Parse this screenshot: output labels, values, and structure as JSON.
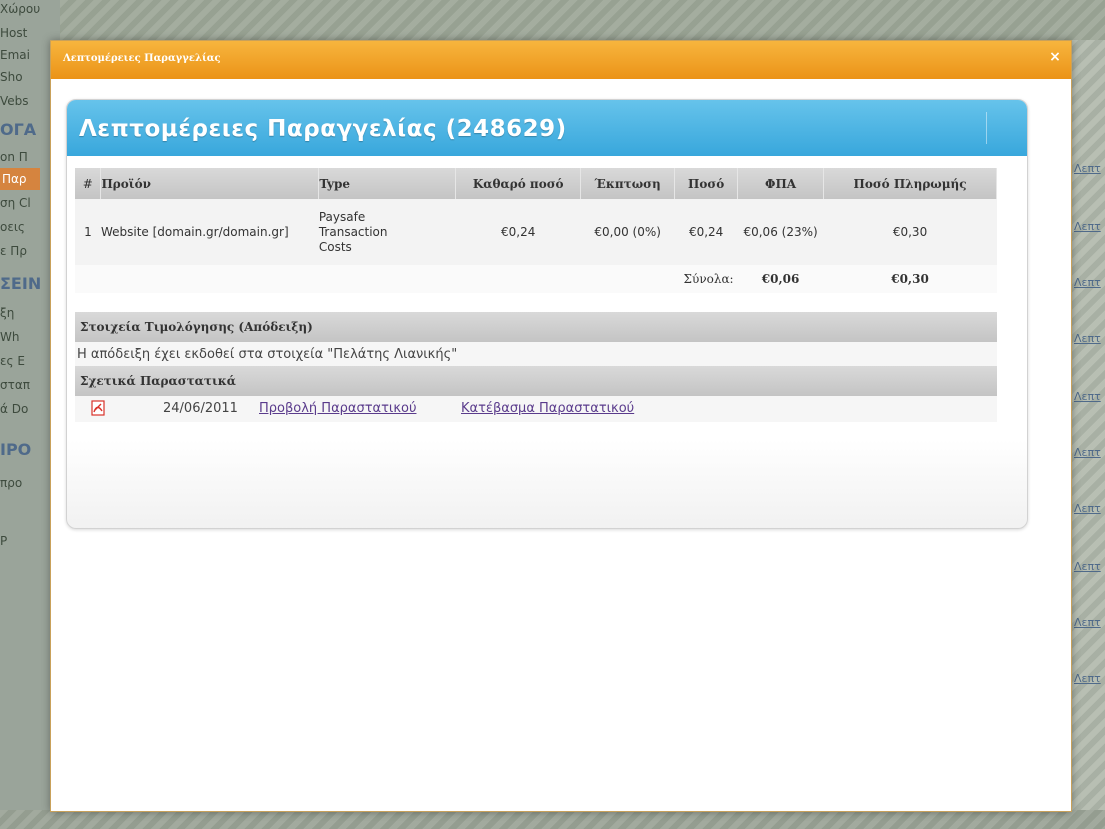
{
  "background": {
    "left_fragments": [
      "Χώρου",
      "Host",
      "Emai",
      "Sho",
      "Vebs",
      "ΟΓΑ",
      "on Π",
      "Παρ",
      "ση Cl",
      "οεις",
      "ε Πρ",
      "ΣΕΙΝ",
      "ξη",
      "Wh",
      "ες E",
      "σταπ",
      "ά Do",
      "ΙΡΟ",
      "προ",
      "P"
    ],
    "right_link": "Λεπτ"
  },
  "modal": {
    "title": "Λεπτομέρειες Παραγγελίας",
    "close_glyph": "×"
  },
  "panel": {
    "title": "Λεπτομέρειες Παραγγελίας (248629)"
  },
  "order_table": {
    "headers": {
      "num": "#",
      "product": "Προϊόν",
      "type": "Type",
      "net": "Καθαρό ποσό",
      "discount": "Έκπτωση",
      "amount": "Ποσό",
      "vat": "ΦΠΑ",
      "payment": "Ποσό Πληρωμής"
    },
    "rows": [
      {
        "num": "1",
        "product": "Website [domain.gr/domain.gr]",
        "type_lines": [
          "Paysafe",
          "Transaction",
          "Costs"
        ],
        "net": "€0,24",
        "discount": "€0,00 (0%)",
        "amount": "€0,24",
        "vat": "€0,06 (23%)",
        "payment": "€0,30"
      }
    ],
    "totals": {
      "label": "Σύνολα:",
      "vat": "€0,06",
      "payment": "€0,30"
    }
  },
  "billing": {
    "title": "Στοιχεία Τιμολόγησης (Απόδειξη)",
    "text": "Η απόδειξη έχει εκδοθεί στα στοιχεία \"Πελάτης Λιανικής\""
  },
  "documents": {
    "title": "Σχετικά Παραστατικά",
    "items": [
      {
        "date": "24/06/2011",
        "view_label": "Προβολή Παραστατικού",
        "download_label": "Κατέβασμα Παραστατικού"
      }
    ]
  },
  "colors": {
    "titlebar": "#eb9317",
    "panel_header": "#38a7dc",
    "link": "#5a3b8c",
    "pdf_icon": "#d9322a"
  }
}
